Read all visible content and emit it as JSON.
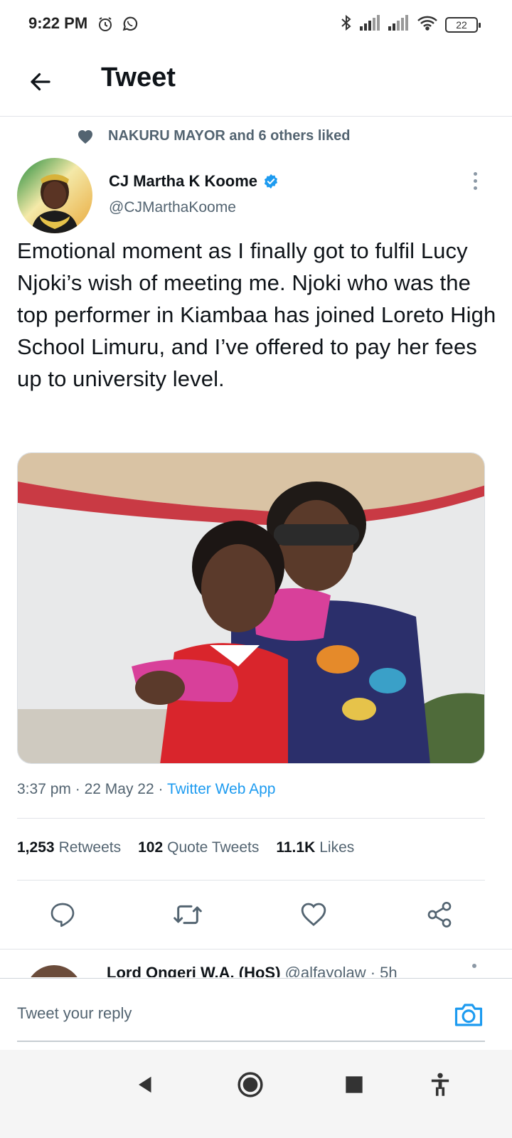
{
  "status_bar": {
    "time": "9:22 PM",
    "battery": "22"
  },
  "header": {
    "title": "Tweet"
  },
  "social_context": {
    "text": "NAKURU MAYOR and 6 others liked"
  },
  "author": {
    "name": "CJ Martha K Koome",
    "handle": "@CJMarthaKoome",
    "verified": true
  },
  "tweet": {
    "text": "Emotional moment as I finally got to fulfil Lucy Njoki’s wish of meeting me. Njoki who was the top performer in Kiambaa has joined Loreto High School Limuru, and I’ve offered to pay her fees up to university level."
  },
  "meta": {
    "time": "3:37 pm",
    "date": "22 May 22",
    "source": "Twitter Web App",
    "separator": "·"
  },
  "stats": {
    "retweets_count": "1,253",
    "retweets_label": "Retweets",
    "quotes_count": "102",
    "quotes_label": "Quote Tweets",
    "likes_count": "11.1K",
    "likes_label": "Likes"
  },
  "reply_preview": {
    "name": "Lord Ongeri W.A. (HoS)",
    "handle_time": "@alfayolaw · 5h"
  },
  "compose": {
    "placeholder": "Tweet your reply"
  },
  "colors": {
    "accent": "#1d9bf0",
    "secondary_text": "#536471",
    "primary_text": "#0f1419"
  }
}
